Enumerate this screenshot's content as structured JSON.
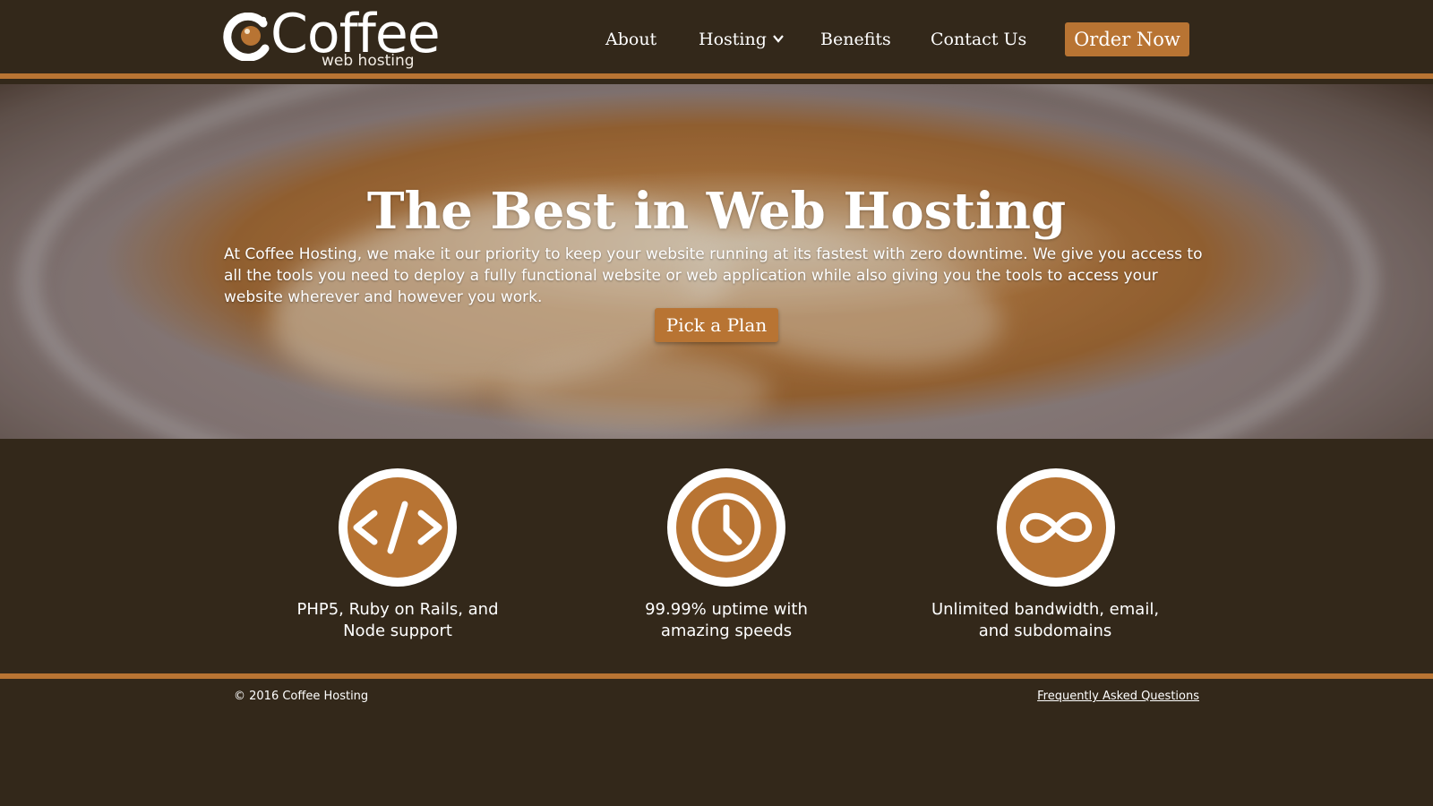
{
  "brand": {
    "name": "Coffee",
    "tagline": "web hosting",
    "logo_icon": "coffee-cup-logo-icon"
  },
  "nav": {
    "items": [
      {
        "label": "About"
      },
      {
        "label": "Hosting",
        "icon": "chevron-down-icon"
      },
      {
        "label": "Benefits"
      },
      {
        "label": "Contact Us"
      }
    ],
    "cta_label": "Order Now"
  },
  "hero": {
    "title": "The Best in Web Hosting",
    "text": "At Coffee Hosting, we make it our priority to keep your website running at its fastest with zero downtime. We give you access to all the tools you need to deploy a fully functional website or web application while also giving you the tools to access your website wherever and however you work.",
    "cta_label": "Pick a Plan"
  },
  "features": [
    {
      "icon": "code-icon",
      "text": "PHP5, Ruby on Rails, and Node support"
    },
    {
      "icon": "clock-icon",
      "text": "99.99% uptime with amazing speeds"
    },
    {
      "icon": "infinity-icon",
      "text": "Unlimited bandwidth, email, and subdomains"
    }
  ],
  "footer": {
    "copyright": "© 2016 Coffee Hosting",
    "faq_label": "Frequently Asked Questions"
  },
  "colors": {
    "background": "#33281a",
    "accent": "#b87433",
    "text": "#ffffff"
  }
}
